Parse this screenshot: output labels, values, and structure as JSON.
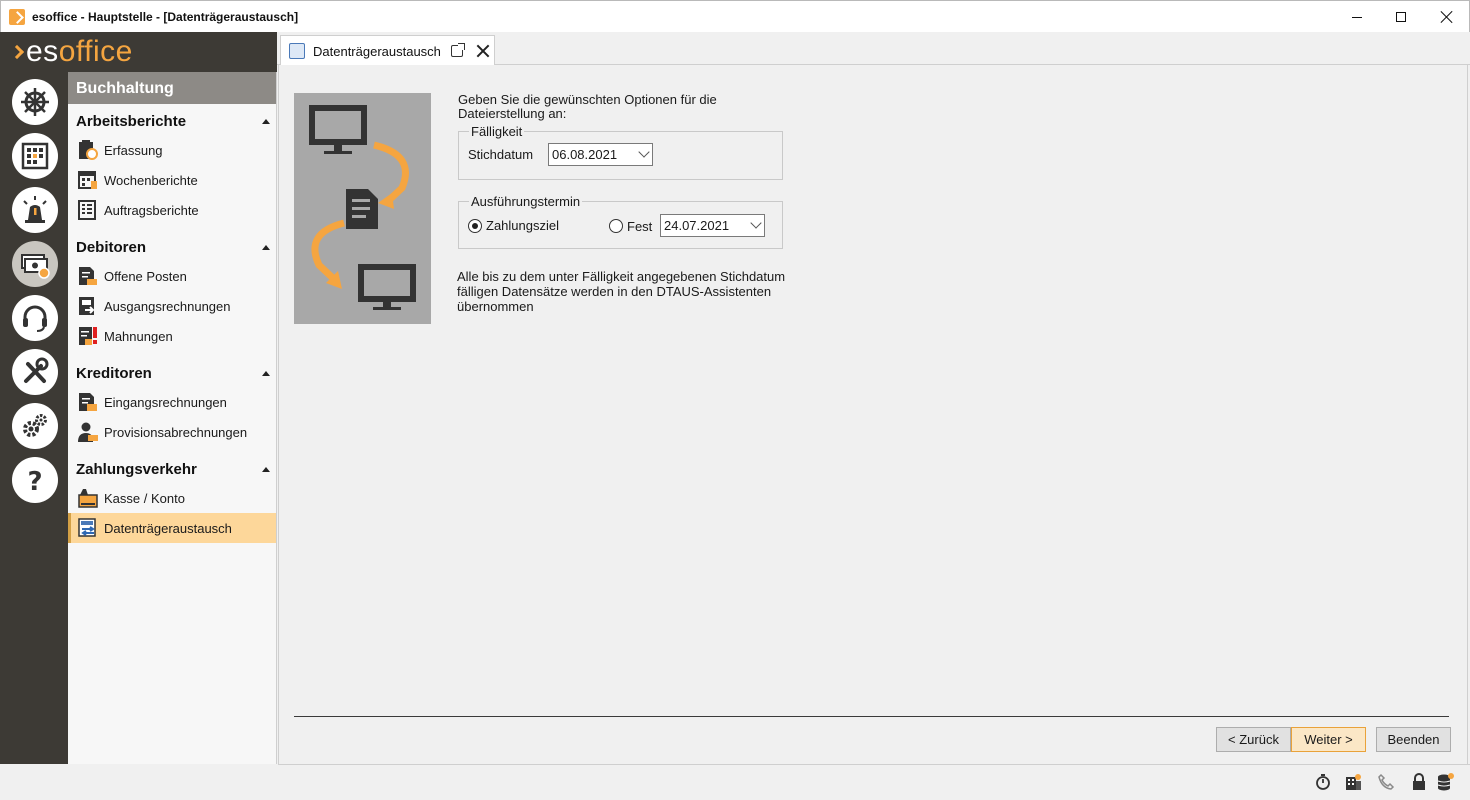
{
  "window": {
    "title": "esoffice - Hauptstelle - [Datenträgeraustausch]"
  },
  "logo": {
    "part1": "es",
    "part2": "office"
  },
  "modules": [
    {
      "icon": "helm-icon"
    },
    {
      "icon": "calendar-grid-icon"
    },
    {
      "icon": "alarm-light-icon"
    },
    {
      "icon": "money-icon",
      "active": true
    },
    {
      "icon": "headset-icon"
    },
    {
      "icon": "tools-icon"
    },
    {
      "icon": "gears-icon"
    },
    {
      "icon": "help-icon"
    }
  ],
  "nav": {
    "header": "Buchhaltung",
    "sections": [
      {
        "title": "Arbeitsberichte",
        "items": [
          "Erfassung",
          "Wochenberichte",
          "Auftragsberichte"
        ]
      },
      {
        "title": "Debitoren",
        "items": [
          "Offene Posten",
          "Ausgangsrechnungen",
          "Mahnungen"
        ]
      },
      {
        "title": "Kreditoren",
        "items": [
          "Eingangsrechnungen",
          "Provisionsabrechnungen"
        ]
      },
      {
        "title": "Zahlungsverkehr",
        "items": [
          "Kasse / Konto",
          "Datenträgeraustausch"
        ]
      }
    ],
    "selected": "Datenträgeraustausch"
  },
  "tab": {
    "label": "Datenträgeraustausch"
  },
  "form": {
    "intro": "Geben Sie die gewünschten Optionen für die Dateierstellung an:",
    "faelligkeit": {
      "legend": "Fälligkeit",
      "stichdatum_label": "Stichdatum",
      "stichdatum_value": "06.08.2021"
    },
    "ausfuehrung": {
      "legend": "Ausführungstermin",
      "option_zahlungsziel": "Zahlungsziel",
      "option_fest": "Fest",
      "fest_value": "24.07.2021",
      "selected": "Zahlungsziel"
    },
    "note": "Alle bis zu dem unter Fälligkeit angegebenen Stichdatum fälligen Datensätze werden in den DTAUS-Assistenten übernommen"
  },
  "buttons": {
    "back": "< Zurück",
    "next": "Weiter >",
    "finish": "Beenden"
  },
  "colors": {
    "accent": "#f5a540",
    "rail": "#3d3a35",
    "selected": "#fdd79a"
  }
}
